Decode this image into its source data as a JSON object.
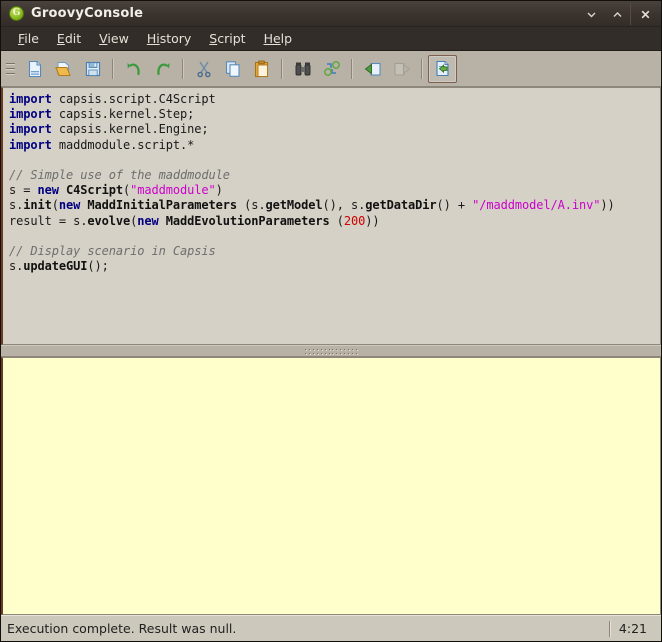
{
  "window": {
    "title": "GroovyConsole",
    "app_icon": "groovy-logo-icon",
    "icon_letter": "G",
    "minimize_label": "⌄",
    "maximize_label": "⌃",
    "close_label": "✕"
  },
  "menubar": {
    "items": [
      {
        "label": "File",
        "mnemonic": "F",
        "rest": "ile"
      },
      {
        "label": "Edit",
        "mnemonic": "E",
        "rest": "dit"
      },
      {
        "label": "View",
        "mnemonic": "V",
        "rest": "iew"
      },
      {
        "label": "History",
        "mnemonic": "Hi",
        "rest": "story"
      },
      {
        "label": "Script",
        "mnemonic": "S",
        "rest": "cript"
      },
      {
        "label": "Help",
        "mnemonic": "He",
        "rest": "lp"
      }
    ]
  },
  "toolbar": {
    "buttons": [
      {
        "name": "new-file-icon",
        "tooltip": "New",
        "enabled": true,
        "active": false
      },
      {
        "name": "open-folder-icon",
        "tooltip": "Open",
        "enabled": true,
        "active": false
      },
      {
        "name": "save-disk-icon",
        "tooltip": "Save",
        "enabled": true,
        "active": false
      },
      {
        "name": "undo-arrow-icon",
        "tooltip": "Undo",
        "enabled": true,
        "active": false
      },
      {
        "name": "redo-arrow-icon",
        "tooltip": "Redo",
        "enabled": true,
        "active": false
      },
      {
        "name": "cut-scissors-icon",
        "tooltip": "Cut",
        "enabled": true,
        "active": false
      },
      {
        "name": "copy-pages-icon",
        "tooltip": "Copy",
        "enabled": true,
        "active": false
      },
      {
        "name": "paste-clipboard-icon",
        "tooltip": "Paste",
        "enabled": true,
        "active": false
      },
      {
        "name": "find-binoculars-icon",
        "tooltip": "Find",
        "enabled": true,
        "active": false
      },
      {
        "name": "replace-icon",
        "tooltip": "Replace",
        "enabled": true,
        "active": false
      },
      {
        "name": "history-previous-icon",
        "tooltip": "Previous",
        "enabled": true,
        "active": false
      },
      {
        "name": "history-next-icon",
        "tooltip": "Next",
        "enabled": false,
        "active": false
      },
      {
        "name": "run-script-icon",
        "tooltip": "Run Script",
        "enabled": true,
        "active": true
      }
    ]
  },
  "editor": {
    "lines": [
      [
        {
          "t": "import",
          "c": "kw"
        },
        {
          "t": " capsis.script.C4Script",
          "c": "id"
        }
      ],
      [
        {
          "t": "import",
          "c": "kw"
        },
        {
          "t": " capsis.kernel.Step;",
          "c": "id"
        }
      ],
      [
        {
          "t": "import",
          "c": "kw"
        },
        {
          "t": " capsis.kernel.Engine;",
          "c": "id"
        }
      ],
      [
        {
          "t": "import",
          "c": "kw"
        },
        {
          "t": " maddmodule.script.*",
          "c": "id"
        }
      ],
      [
        {
          "t": "",
          "c": "id"
        }
      ],
      [
        {
          "t": "// Simple use of the maddmodule",
          "c": "cmt"
        }
      ],
      [
        {
          "t": "s = ",
          "c": "id"
        },
        {
          "t": "new",
          "c": "kw"
        },
        {
          "t": " ",
          "c": "id"
        },
        {
          "t": "C4Script",
          "c": "bold"
        },
        {
          "t": "(",
          "c": "id"
        },
        {
          "t": "\"maddmodule\"",
          "c": "str"
        },
        {
          "t": ")",
          "c": "id"
        }
      ],
      [
        {
          "t": "s.",
          "c": "id"
        },
        {
          "t": "init",
          "c": "bold"
        },
        {
          "t": "(",
          "c": "id"
        },
        {
          "t": "new",
          "c": "kw"
        },
        {
          "t": " ",
          "c": "id"
        },
        {
          "t": "MaddInitialParameters",
          "c": "bold"
        },
        {
          "t": " (s.",
          "c": "id"
        },
        {
          "t": "getModel",
          "c": "bold"
        },
        {
          "t": "(), s.",
          "c": "id"
        },
        {
          "t": "getDataDir",
          "c": "bold"
        },
        {
          "t": "() + ",
          "c": "id"
        },
        {
          "t": "\"/maddmodel/A.inv\"",
          "c": "str"
        },
        {
          "t": "))",
          "c": "id"
        }
      ],
      [
        {
          "t": "result = s.",
          "c": "id"
        },
        {
          "t": "evolve",
          "c": "bold"
        },
        {
          "t": "(",
          "c": "id"
        },
        {
          "t": "new",
          "c": "kw"
        },
        {
          "t": " ",
          "c": "id"
        },
        {
          "t": "MaddEvolutionParameters",
          "c": "bold"
        },
        {
          "t": " (",
          "c": "id"
        },
        {
          "t": "200",
          "c": "num"
        },
        {
          "t": "))",
          "c": "id"
        }
      ],
      [
        {
          "t": "",
          "c": "id"
        }
      ],
      [
        {
          "t": "// Display scenario in Capsis",
          "c": "cmt"
        }
      ],
      [
        {
          "t": "s.",
          "c": "id"
        },
        {
          "t": "updateGUI",
          "c": "bold"
        },
        {
          "t": "();",
          "c": "id"
        }
      ]
    ]
  },
  "output": {
    "text": ""
  },
  "statusbar": {
    "message": "Execution complete. Result was null.",
    "position": "4:21"
  },
  "colors": {
    "titlebar": "#3a332e",
    "toolbar": "#b8b2a6",
    "editor_bg": "#d6d1c6",
    "output_bg": "#ffffcc",
    "status_bg": "#cdc8bc",
    "keyword": "#000080",
    "comment": "#6e6e6e",
    "string": "#cc00cc",
    "number": "#cc0000",
    "accent_border": "#6b3b1f"
  }
}
